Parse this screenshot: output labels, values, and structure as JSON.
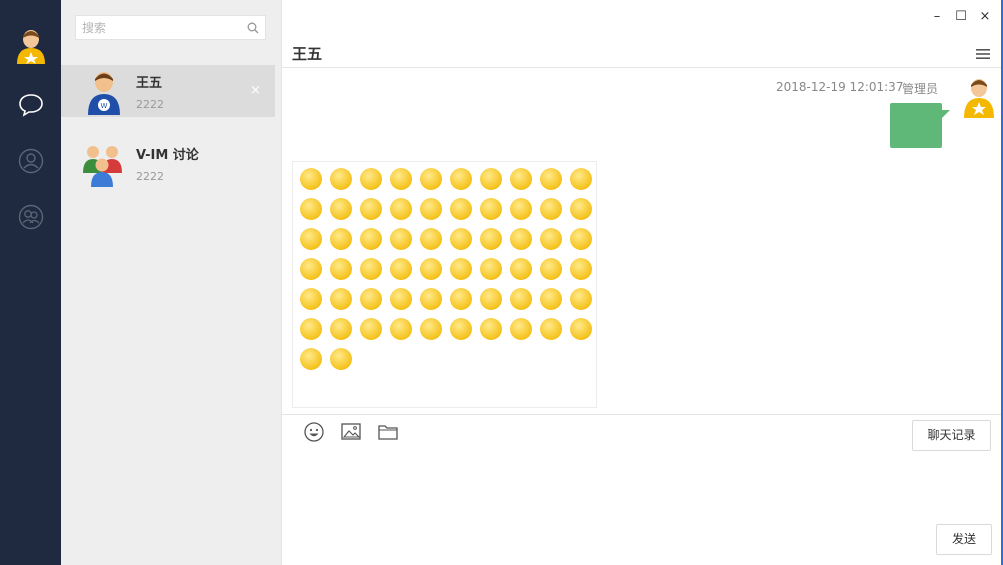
{
  "window": {
    "minimize": "–",
    "maximize": "☐",
    "close": "×"
  },
  "search": {
    "placeholder": "搜索"
  },
  "contacts": [
    {
      "name": "王五",
      "sub": "2222",
      "active": true,
      "close": "×"
    },
    {
      "name": "V-IM 讨论",
      "sub": "2222",
      "active": false
    }
  ],
  "chat": {
    "title": "王五",
    "message": {
      "time": "2018-12-19 12:01:37",
      "sender": "管理员"
    },
    "history_label": "聊天记录",
    "send_label": "发送"
  },
  "emoji_count": 62,
  "colors": {
    "rail": "#1f2a40",
    "list_bg": "#eeeeee",
    "bubble": "#5fb878",
    "active_item": "#dcdcdc"
  }
}
